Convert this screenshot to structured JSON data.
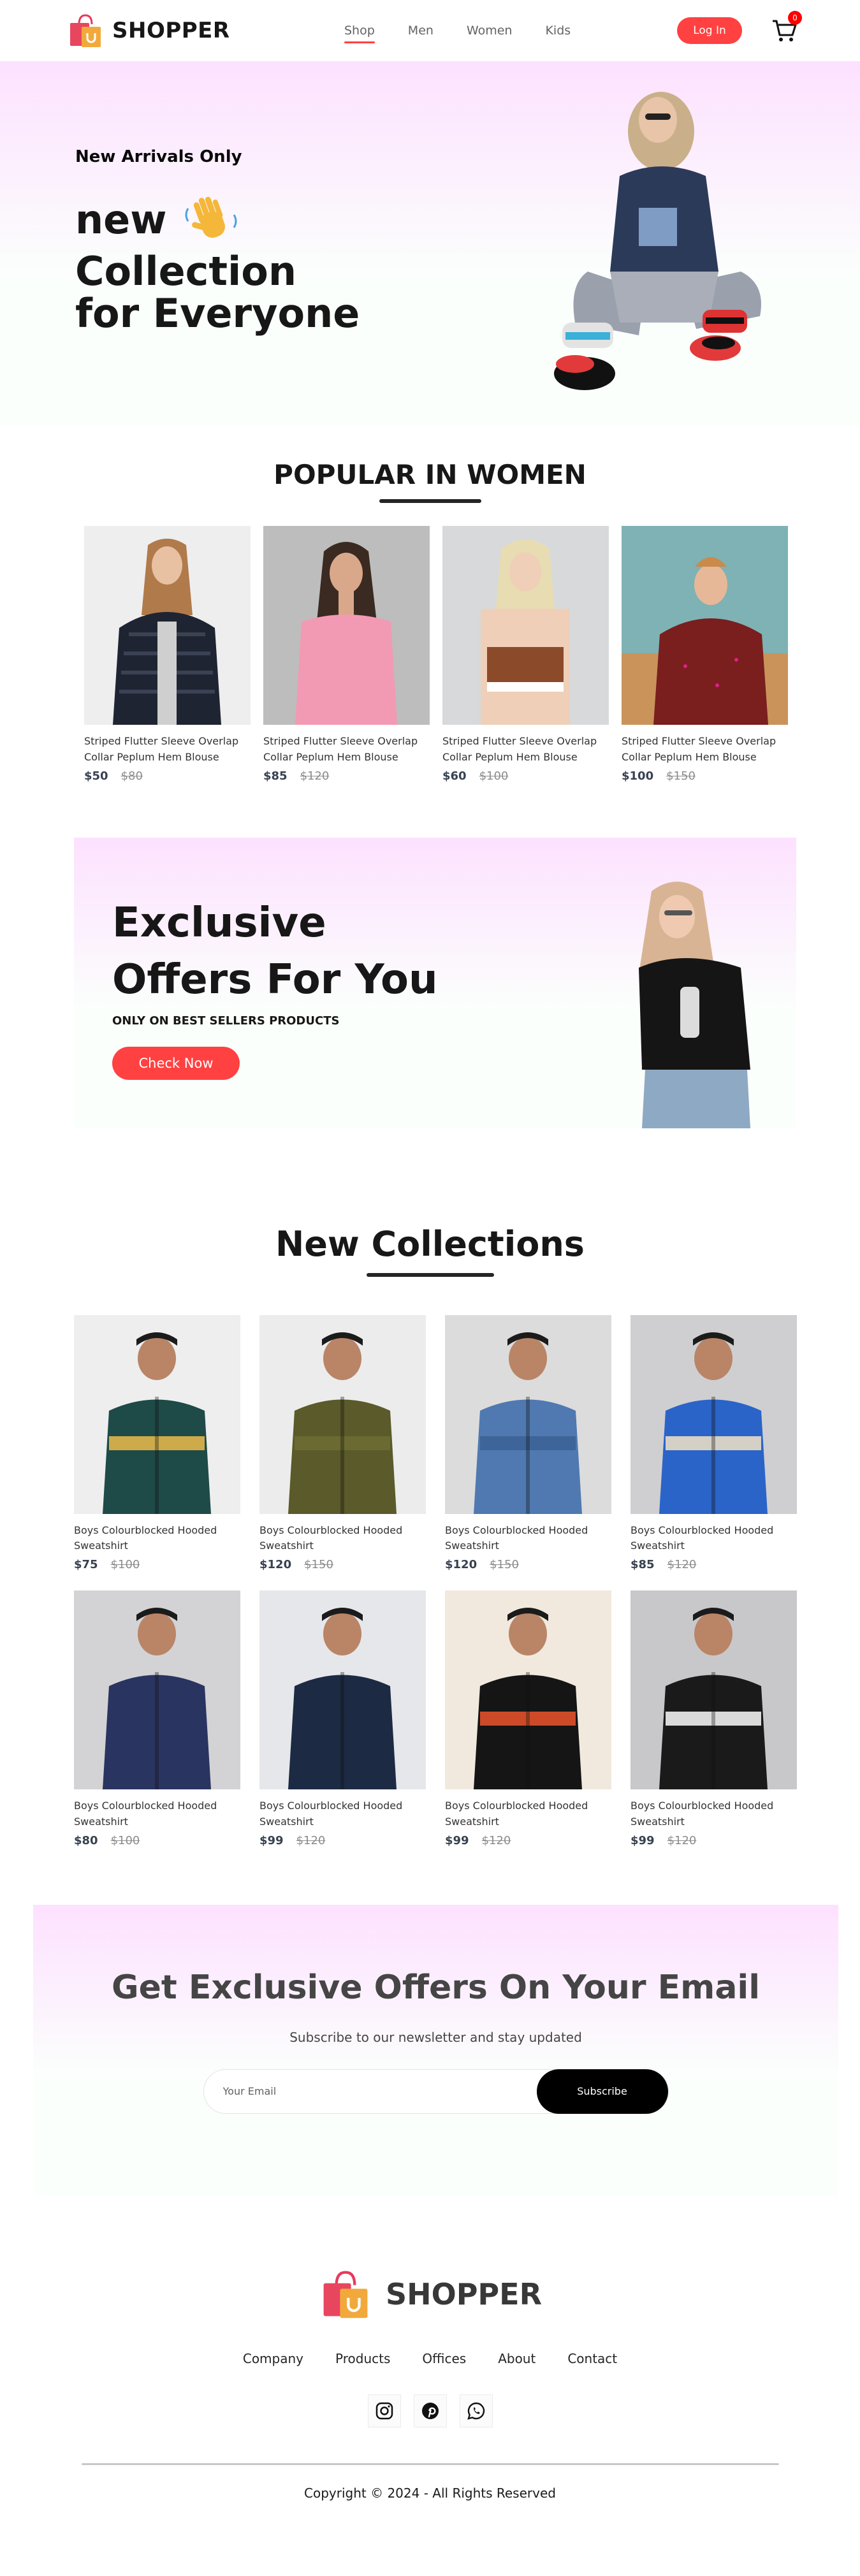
{
  "brand": {
    "name": "SHOPPER"
  },
  "nav": {
    "items": [
      {
        "label": "Shop",
        "active": true
      },
      {
        "label": "Men",
        "active": false
      },
      {
        "label": "Women",
        "active": false
      },
      {
        "label": "Kids",
        "active": false
      }
    ],
    "login_label": "Log In",
    "cart_count": "0"
  },
  "hero": {
    "tag": "New Arrivals Only",
    "line1": "new",
    "line2": "Collection",
    "line3": "for Everyone"
  },
  "popular": {
    "title": "POPULAR IN WOMEN",
    "items": [
      {
        "name": "Striped Flutter Sleeve Overlap Collar Peplum Hem Blouse",
        "new_price": "$50",
        "old_price": "$80",
        "image_icon": "woman-puffer-jacket-photo"
      },
      {
        "name": "Striped Flutter Sleeve Overlap Collar Peplum Hem Blouse",
        "new_price": "$85",
        "old_price": "$120",
        "image_icon": "woman-pink-top-photo"
      },
      {
        "name": "Striped Flutter Sleeve Overlap Collar Peplum Hem Blouse",
        "new_price": "$60",
        "old_price": "$100",
        "image_icon": "woman-crop-top-photo"
      },
      {
        "name": "Striped Flutter Sleeve Overlap Collar Peplum Hem Blouse",
        "new_price": "$100",
        "old_price": "$150",
        "image_icon": "woman-red-blouse-photo"
      }
    ]
  },
  "offers": {
    "line1": "Exclusive",
    "line2": "Offers For You",
    "subtitle": "ONLY ON BEST SELLERS PRODUCTS",
    "button_label": "Check Now"
  },
  "collections": {
    "title": "New Collections",
    "items": [
      {
        "name": "Boys Colourblocked Hooded Sweatshirt",
        "new_price": "$75",
        "old_price": "$100",
        "jacket_color": "#1e4a48",
        "accent": "#e0b64a"
      },
      {
        "name": "Boys Colourblocked Hooded Sweatshirt",
        "new_price": "$120",
        "old_price": "$150",
        "jacket_color": "#5a5a2a",
        "accent": "#6b6b33"
      },
      {
        "name": "Boys Colourblocked Hooded Sweatshirt",
        "new_price": "$120",
        "old_price": "$150",
        "jacket_color": "#4f79b0",
        "accent": "#3b6397"
      },
      {
        "name": "Boys Colourblocked Hooded Sweatshirt",
        "new_price": "$85",
        "old_price": "$120",
        "jacket_color": "#2b64c8",
        "accent": "#e8dcc4"
      },
      {
        "name": "Boys Colourblocked Hooded Sweatshirt",
        "new_price": "$80",
        "old_price": "$100",
        "jacket_color": "#2a3460",
        "accent": "#2a3460"
      },
      {
        "name": "Boys Colourblocked Hooded Sweatshirt",
        "new_price": "$99",
        "old_price": "$120",
        "jacket_color": "#1d2a44",
        "accent": "#1d2a44"
      },
      {
        "name": "Boys Colourblocked Hooded Sweatshirt",
        "new_price": "$99",
        "old_price": "$120",
        "jacket_color": "#151515",
        "accent": "#e0502a"
      },
      {
        "name": "Boys Colourblocked Hooded Sweatshirt",
        "new_price": "$99",
        "old_price": "$120",
        "jacket_color": "#1a1a1a",
        "accent": "#f0f0f0"
      }
    ]
  },
  "newsletter": {
    "title": "Get Exclusive Offers On Your Email",
    "subtitle": "Subscribe to our newsletter and stay updated",
    "placeholder": "Your Email",
    "button_label": "Subscribe"
  },
  "footer": {
    "brand": "SHOPPER",
    "links": [
      "Company",
      "Products",
      "Offices",
      "About",
      "Contact"
    ],
    "social": [
      "instagram-icon",
      "pinterest-icon",
      "whatsapp-icon"
    ],
    "copyright": "Copyright © 2024 - All Rights Reserved"
  },
  "colors": {
    "accent": "#ff4141",
    "hero_gradient_top": "#fde1ff"
  }
}
